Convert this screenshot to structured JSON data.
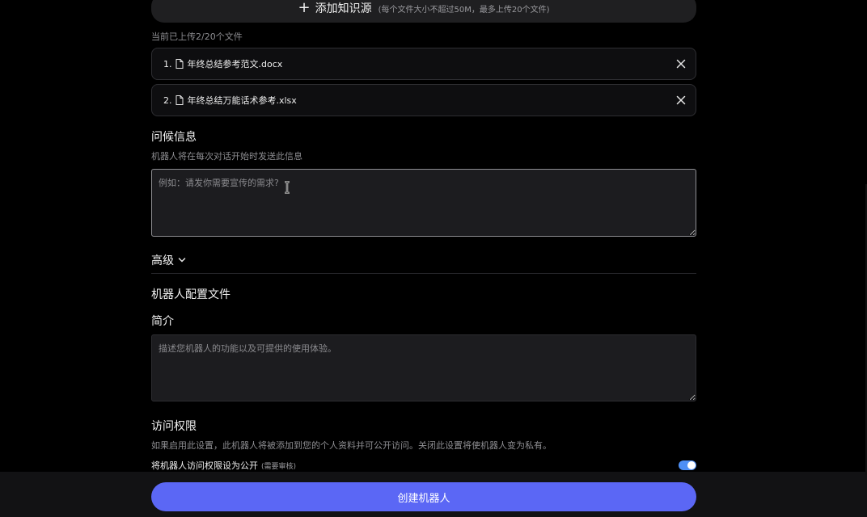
{
  "knowledge": {
    "add_label": "添加知识源",
    "add_hint": "(每个文件大小不超过50M，最多上传20个文件)",
    "upload_count": "当前已上传2/20个文件",
    "files": [
      {
        "index": "1.",
        "name": "年终总结参考范文.docx"
      },
      {
        "index": "2.",
        "name": "年终总结万能话术参考.xlsx"
      }
    ]
  },
  "greeting": {
    "title": "问候信息",
    "description": "机器人将在每次对话开始时发送此信息",
    "placeholder": "例如：请发你需要宣传的需求?",
    "value": ""
  },
  "advanced": {
    "label": "高级"
  },
  "profile": {
    "title": "机器人配置文件",
    "intro_title": "简介",
    "intro_placeholder": "描述您机器人的功能以及可提供的使用体验。",
    "intro_value": ""
  },
  "access": {
    "title": "访问权限",
    "description": "如果启用此设置，此机器人将被添加到您的个人资料并可公开访问。关闭此设置将使机器人变为私有。",
    "public_label": "将机器人访问权限设为公开",
    "public_sub": "(需要审核)",
    "public_enabled": true
  },
  "footer": {
    "create_label": "创建机器人"
  },
  "colors": {
    "accent": "#5b67f5",
    "toggle_on": "#4e8ff5",
    "background": "#000000"
  },
  "icons": [
    "plus-icon",
    "document-icon",
    "close-icon",
    "chevron-down-icon",
    "text-cursor-icon"
  ]
}
